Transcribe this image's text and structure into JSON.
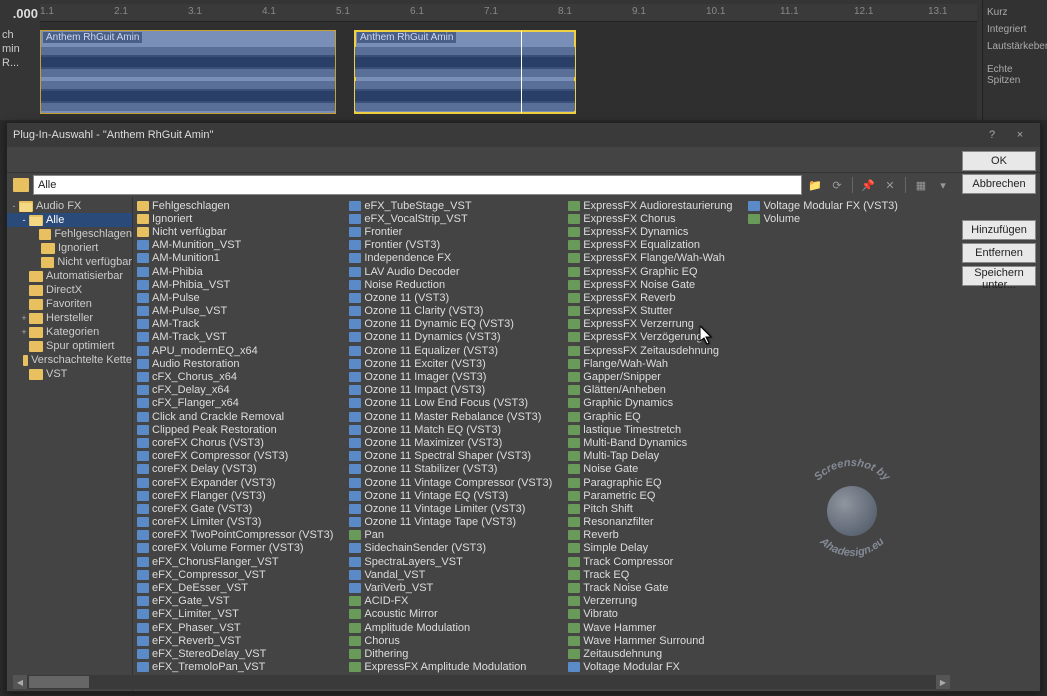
{
  "timeline": {
    "time": ".000",
    "ticks": [
      "1.1",
      "2.1",
      "3.1",
      "4.1",
      "5.1",
      "6.1",
      "7.1",
      "8.1",
      "9.1",
      "10.1",
      "11.1",
      "12.1",
      "13.1"
    ],
    "clip_label": "Anthem RhGuit Amin",
    "side": [
      "ch",
      "min R..."
    ]
  },
  "right_top": [
    "Kurz",
    "Integriert",
    "Lautstärkeberei",
    "",
    "Echte Spitzen"
  ],
  "dialog": {
    "title": "Plug-In-Auswahl - \"Anthem RhGuit Amin\"",
    "help": "?",
    "close": "×"
  },
  "buttons": {
    "ok": "OK",
    "cancel": "Abbrechen",
    "add": "Hinzufügen",
    "remove": "Entfernen",
    "save_as": "Speichern unter..."
  },
  "path": {
    "value": "Alle"
  },
  "tree": [
    {
      "l": "Audio FX",
      "d": 0,
      "e": "-",
      "o": true
    },
    {
      "l": "Alle",
      "d": 1,
      "e": "-",
      "o": true,
      "sel": true
    },
    {
      "l": "Fehlgeschlagen",
      "d": 2,
      "e": ""
    },
    {
      "l": "Ignoriert",
      "d": 2,
      "e": ""
    },
    {
      "l": "Nicht verfügbar",
      "d": 2,
      "e": ""
    },
    {
      "l": "Automatisierbar",
      "d": 1,
      "e": ""
    },
    {
      "l": "DirectX",
      "d": 1,
      "e": ""
    },
    {
      "l": "Favoriten",
      "d": 1,
      "e": ""
    },
    {
      "l": "Hersteller",
      "d": 1,
      "e": "+"
    },
    {
      "l": "Kategorien",
      "d": 1,
      "e": "+"
    },
    {
      "l": "Spur optimiert",
      "d": 1,
      "e": ""
    },
    {
      "l": "Verschachtelte Kette",
      "d": 1,
      "e": ""
    },
    {
      "l": "VST",
      "d": 1,
      "e": ""
    }
  ],
  "columns": [
    [
      {
        "t": "f",
        "l": "Fehlgeschlagen"
      },
      {
        "t": "f",
        "l": "Ignoriert"
      },
      {
        "t": "f",
        "l": "Nicht verfügbar"
      },
      {
        "t": "x",
        "l": "AM-Munition_VST"
      },
      {
        "t": "x",
        "l": "AM-Munition1"
      },
      {
        "t": "x",
        "l": "AM-Phibia"
      },
      {
        "t": "x",
        "l": "AM-Phibia_VST"
      },
      {
        "t": "x",
        "l": "AM-Pulse"
      },
      {
        "t": "x",
        "l": "AM-Pulse_VST"
      },
      {
        "t": "x",
        "l": "AM-Track"
      },
      {
        "t": "x",
        "l": "AM-Track_VST"
      },
      {
        "t": "x",
        "l": "APU_modernEQ_x64"
      },
      {
        "t": "x",
        "l": "Audio Restoration"
      },
      {
        "t": "x",
        "l": "cFX_Chorus_x64"
      },
      {
        "t": "x",
        "l": "cFX_Delay_x64"
      },
      {
        "t": "x",
        "l": "cFX_Flanger_x64"
      },
      {
        "t": "x",
        "l": "Click and Crackle Removal"
      },
      {
        "t": "x",
        "l": "Clipped Peak Restoration"
      },
      {
        "t": "x",
        "l": "coreFX Chorus (VST3)"
      },
      {
        "t": "x",
        "l": "coreFX Compressor (VST3)"
      },
      {
        "t": "x",
        "l": "coreFX Delay (VST3)"
      },
      {
        "t": "x",
        "l": "coreFX Expander (VST3)"
      },
      {
        "t": "x",
        "l": "coreFX Flanger (VST3)"
      },
      {
        "t": "x",
        "l": "coreFX Gate (VST3)"
      },
      {
        "t": "x",
        "l": "coreFX Limiter (VST3)"
      },
      {
        "t": "x",
        "l": "coreFX TwoPointCompressor (VST3)"
      },
      {
        "t": "x",
        "l": "coreFX Volume Former (VST3)"
      },
      {
        "t": "x",
        "l": "eFX_ChorusFlanger_VST"
      },
      {
        "t": "x",
        "l": "eFX_Compressor_VST"
      },
      {
        "t": "x",
        "l": "eFX_DeEsser_VST"
      },
      {
        "t": "x",
        "l": "eFX_Gate_VST"
      },
      {
        "t": "x",
        "l": "eFX_Limiter_VST"
      },
      {
        "t": "x",
        "l": "eFX_Phaser_VST"
      },
      {
        "t": "x",
        "l": "eFX_Reverb_VST"
      },
      {
        "t": "x",
        "l": "eFX_StereoDelay_VST"
      },
      {
        "t": "x",
        "l": "eFX_TremoloPan_VST"
      }
    ],
    [
      {
        "t": "x",
        "l": "eFX_TubeStage_VST"
      },
      {
        "t": "x",
        "l": "eFX_VocalStrip_VST"
      },
      {
        "t": "x",
        "l": "Frontier"
      },
      {
        "t": "x",
        "l": "Frontier (VST3)"
      },
      {
        "t": "x",
        "l": "Independence FX"
      },
      {
        "t": "x",
        "l": "LAV Audio Decoder"
      },
      {
        "t": "x",
        "l": "Noise Reduction"
      },
      {
        "t": "x",
        "l": "Ozone 11 (VST3)"
      },
      {
        "t": "x",
        "l": "Ozone 11 Clarity (VST3)"
      },
      {
        "t": "x",
        "l": "Ozone 11 Dynamic EQ (VST3)"
      },
      {
        "t": "x",
        "l": "Ozone 11 Dynamics (VST3)"
      },
      {
        "t": "x",
        "l": "Ozone 11 Equalizer (VST3)"
      },
      {
        "t": "x",
        "l": "Ozone 11 Exciter (VST3)"
      },
      {
        "t": "x",
        "l": "Ozone 11 Imager (VST3)"
      },
      {
        "t": "x",
        "l": "Ozone 11 Impact (VST3)"
      },
      {
        "t": "x",
        "l": "Ozone 11 Low End Focus (VST3)"
      },
      {
        "t": "x",
        "l": "Ozone 11 Master Rebalance (VST3)"
      },
      {
        "t": "x",
        "l": "Ozone 11 Match EQ (VST3)"
      },
      {
        "t": "x",
        "l": "Ozone 11 Maximizer (VST3)"
      },
      {
        "t": "x",
        "l": "Ozone 11 Spectral Shaper (VST3)"
      },
      {
        "t": "x",
        "l": "Ozone 11 Stabilizer (VST3)"
      },
      {
        "t": "x",
        "l": "Ozone 11 Vintage Compressor (VST3)"
      },
      {
        "t": "x",
        "l": "Ozone 11 Vintage EQ (VST3)"
      },
      {
        "t": "x",
        "l": "Ozone 11 Vintage Limiter (VST3)"
      },
      {
        "t": "x",
        "l": "Ozone 11 Vintage Tape (VST3)"
      },
      {
        "t": "g",
        "l": "Pan"
      },
      {
        "t": "x",
        "l": "SidechainSender (VST3)"
      },
      {
        "t": "x",
        "l": "SpectraLayers_VST"
      },
      {
        "t": "x",
        "l": "Vandal_VST"
      },
      {
        "t": "x",
        "l": "VariVerb_VST"
      },
      {
        "t": "g",
        "l": "ACID-FX"
      },
      {
        "t": "g",
        "l": "Acoustic Mirror"
      },
      {
        "t": "g",
        "l": "Amplitude Modulation"
      },
      {
        "t": "g",
        "l": "Chorus"
      },
      {
        "t": "g",
        "l": "Dithering"
      },
      {
        "t": "g",
        "l": "ExpressFX Amplitude Modulation"
      }
    ],
    [
      {
        "t": "g",
        "l": "ExpressFX Audiorestaurierung"
      },
      {
        "t": "g",
        "l": "ExpressFX Chorus"
      },
      {
        "t": "g",
        "l": "ExpressFX Dynamics"
      },
      {
        "t": "g",
        "l": "ExpressFX Equalization"
      },
      {
        "t": "g",
        "l": "ExpressFX Flange/Wah-Wah"
      },
      {
        "t": "g",
        "l": "ExpressFX Graphic EQ"
      },
      {
        "t": "g",
        "l": "ExpressFX Noise Gate"
      },
      {
        "t": "g",
        "l": "ExpressFX Reverb"
      },
      {
        "t": "g",
        "l": "ExpressFX Stutter"
      },
      {
        "t": "g",
        "l": "ExpressFX Verzerrung"
      },
      {
        "t": "g",
        "l": "ExpressFX Verzögerung"
      },
      {
        "t": "g",
        "l": "ExpressFX Zeitausdehnung"
      },
      {
        "t": "g",
        "l": "Flange/Wah-Wah"
      },
      {
        "t": "g",
        "l": "Gapper/Snipper"
      },
      {
        "t": "g",
        "l": "Glätten/Anheben"
      },
      {
        "t": "g",
        "l": "Graphic Dynamics"
      },
      {
        "t": "g",
        "l": "Graphic EQ"
      },
      {
        "t": "g",
        "l": "lastique Timestretch"
      },
      {
        "t": "g",
        "l": "Multi-Band Dynamics"
      },
      {
        "t": "g",
        "l": "Multi-Tap Delay"
      },
      {
        "t": "g",
        "l": "Noise Gate"
      },
      {
        "t": "g",
        "l": "Paragraphic EQ"
      },
      {
        "t": "g",
        "l": "Parametric EQ"
      },
      {
        "t": "g",
        "l": "Pitch Shift"
      },
      {
        "t": "g",
        "l": "Resonanzfilter"
      },
      {
        "t": "g",
        "l": "Reverb"
      },
      {
        "t": "g",
        "l": "Simple Delay"
      },
      {
        "t": "g",
        "l": "Track Compressor"
      },
      {
        "t": "g",
        "l": "Track EQ"
      },
      {
        "t": "g",
        "l": "Track Noise Gate"
      },
      {
        "t": "g",
        "l": "Verzerrung"
      },
      {
        "t": "g",
        "l": "Vibrato"
      },
      {
        "t": "g",
        "l": "Wave Hammer"
      },
      {
        "t": "g",
        "l": "Wave Hammer Surround"
      },
      {
        "t": "g",
        "l": "Zeitausdehnung"
      },
      {
        "t": "x",
        "l": "Voltage Modular FX"
      }
    ],
    [
      {
        "t": "x",
        "l": "Voltage Modular FX (VST3)"
      },
      {
        "t": "g",
        "l": "Volume"
      }
    ]
  ],
  "watermark": {
    "top": "Screenshot by",
    "bottom": "Ahadesign.eu"
  }
}
